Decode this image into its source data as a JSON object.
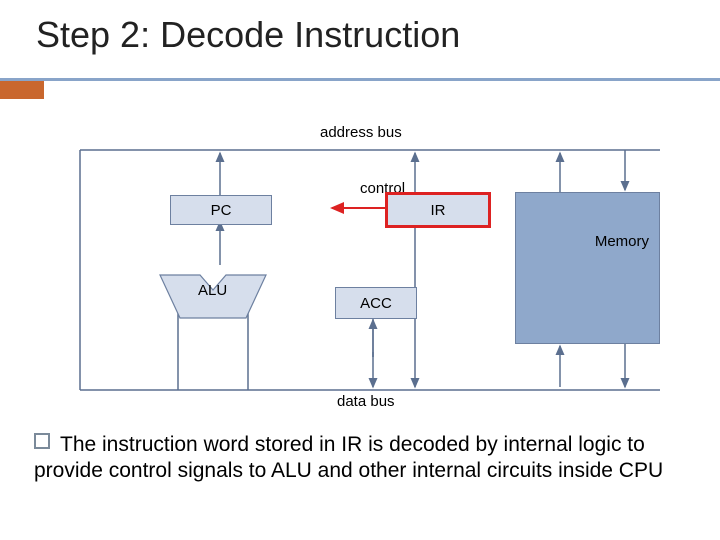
{
  "title": "Step 2: Decode Instruction",
  "labels": {
    "address_bus": "address  bus",
    "data_bus": "data  bus",
    "control": "control"
  },
  "blocks": {
    "pc": "PC",
    "ir": "IR",
    "alu": "ALU",
    "acc": "ACC",
    "memory": "Memory"
  },
  "bullet": "The instruction word stored in IR is decoded by internal logic to provide control signals to ALU and other internal circuits inside CPU"
}
